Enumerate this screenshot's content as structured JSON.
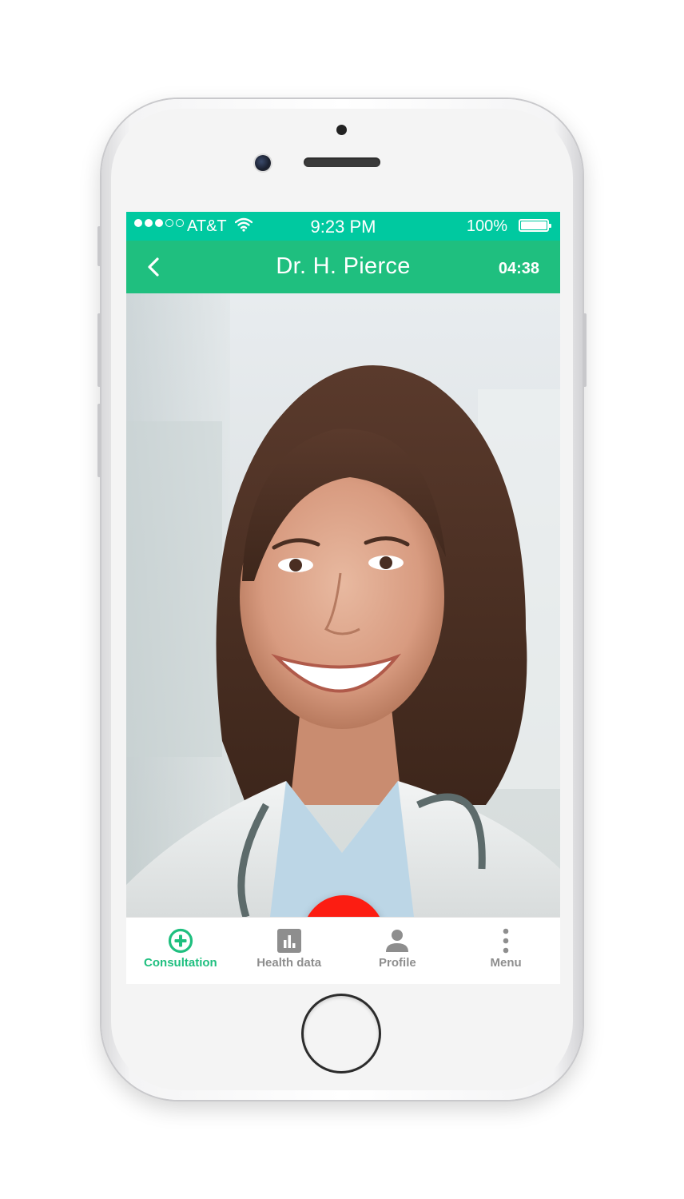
{
  "status_bar": {
    "carrier": "AT&T",
    "time": "9:23 PM",
    "battery": "100%",
    "signal_icon": "signal-dots-icon",
    "wifi_icon": "wifi-icon",
    "battery_icon": "battery-icon"
  },
  "header": {
    "title": "Dr. H. Pierce",
    "call_timer": "04:38",
    "back_icon": "chevron-left-icon"
  },
  "call": {
    "end_call_icon": "phone-hangup-icon"
  },
  "tabs": [
    {
      "label": "Consultation",
      "icon": "plus-circle-icon",
      "active": true
    },
    {
      "label": "Health data",
      "icon": "bar-chart-icon",
      "active": false
    },
    {
      "label": "Profile",
      "icon": "person-icon",
      "active": false
    },
    {
      "label": "Menu",
      "icon": "more-vertical-icon",
      "active": false
    }
  ],
  "colors": {
    "status_bar": "#00c9a0",
    "app_bar": "#1fbf7f",
    "accent": "#1fbf7f",
    "hangup": "#fc1d12",
    "tab_inactive": "#8e8e8e"
  }
}
